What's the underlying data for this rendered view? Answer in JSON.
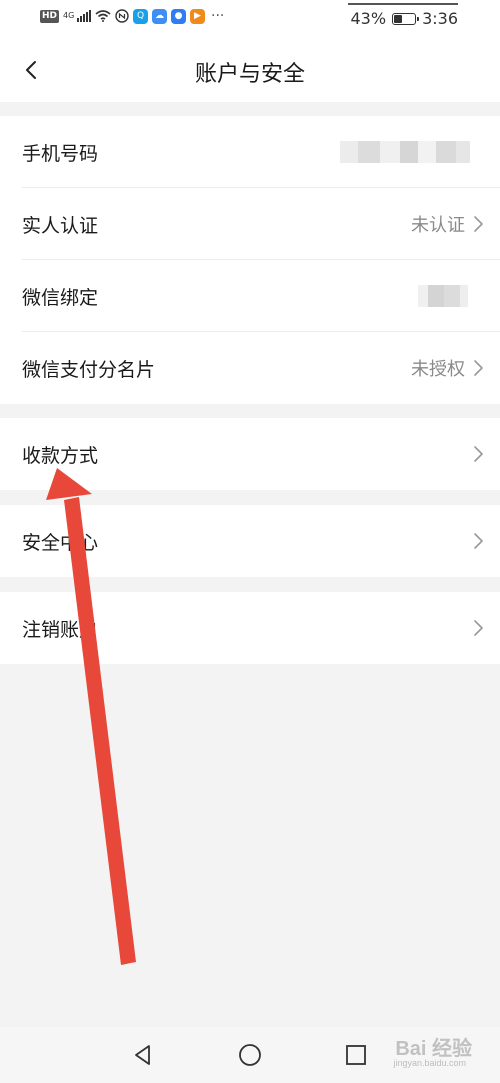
{
  "status_bar": {
    "hd": "HD",
    "network": "4G",
    "more": "···",
    "battery_percent": "43%",
    "battery_level": 0.43,
    "time": "3:36",
    "app_icons": [
      {
        "name": "search-app-icon",
        "color": "#1aa0e8",
        "glyph": "Q"
      },
      {
        "name": "cloud-app-icon",
        "color": "#3d8ff5",
        "glyph": "☁"
      },
      {
        "name": "bulb-app-icon",
        "color": "#2f7df0",
        "glyph": "●"
      },
      {
        "name": "play-app-icon",
        "color": "#f08a1a",
        "glyph": "▶"
      }
    ]
  },
  "header": {
    "title": "账户与安全",
    "back_icon": "chevron-left-icon"
  },
  "groups": [
    {
      "items": [
        {
          "label": "手机号码",
          "value": "",
          "redacted": true,
          "chevron": false
        },
        {
          "label": "实人认证",
          "value": "未认证",
          "redacted": false,
          "chevron": true
        },
        {
          "label": "微信绑定",
          "value": "",
          "redacted": true,
          "chevron": false
        },
        {
          "label": "微信支付分名片",
          "value": "未授权",
          "redacted": false,
          "chevron": true
        }
      ]
    },
    {
      "items": [
        {
          "label": "收款方式",
          "value": "",
          "redacted": false,
          "chevron": true
        }
      ]
    },
    {
      "items": [
        {
          "label": "安全中心",
          "value": "",
          "redacted": false,
          "chevron": true
        }
      ]
    },
    {
      "items": [
        {
          "label": "注销账户",
          "value": "",
          "redacted": false,
          "chevron": true
        }
      ]
    }
  ],
  "bottom_nav": {
    "back": "triangle-back-icon",
    "home": "circle-home-icon",
    "recents": "square-recents-icon"
  },
  "watermark": {
    "text": "Bai 经验",
    "sub": "jingyan.baidu.com"
  },
  "colors": {
    "annotation_arrow": "#e8483a",
    "background": "#f3f3f3",
    "card": "#ffffff",
    "secondary_text": "#8a8a8a"
  }
}
